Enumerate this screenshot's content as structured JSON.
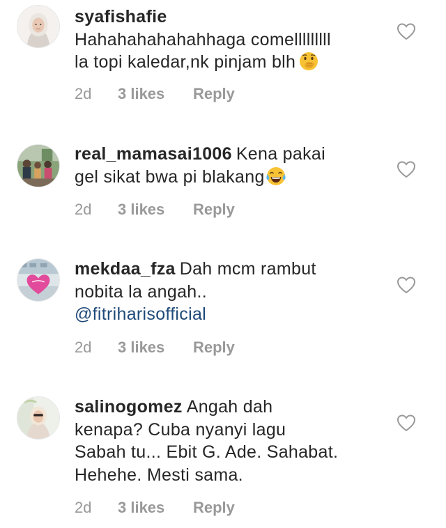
{
  "comments": [
    {
      "username": "syafishafie",
      "line1": "Hahahahahahahhaga comelllllllll",
      "line2": "la topi kaledar,nk pinjam blh",
      "emoji": "face-with-hand-over-mouth-emoji",
      "time": "2d",
      "likes": "3 likes",
      "reply": "Reply"
    },
    {
      "username": "real_mamasai1006",
      "line1": "Kena pakai",
      "line2": "gel sikat bwa pi blakang",
      "emoji": "tears-of-joy-emoji",
      "time": "2d",
      "likes": "3 likes",
      "reply": "Reply"
    },
    {
      "username": "mekdaa_fza",
      "line1": "Dah mcm rambut",
      "line2": "nobita la angah..",
      "mention": "@fitriharisofficial",
      "time": "2d",
      "likes": "3 likes",
      "reply": "Reply"
    },
    {
      "username": "salinogomez",
      "line1": "Angah dah",
      "line2": "kenapa? Cuba nyanyi lagu",
      "line3": "Sabah tu... Ebit G. Ade. Sahabat.",
      "line4": "Hehehe. Mesti sama.",
      "time": "2d",
      "likes": "3 likes",
      "reply": "Reply"
    }
  ],
  "colors": {
    "text": "#262626",
    "meta": "#999999",
    "mention": "#1f4a7a"
  }
}
